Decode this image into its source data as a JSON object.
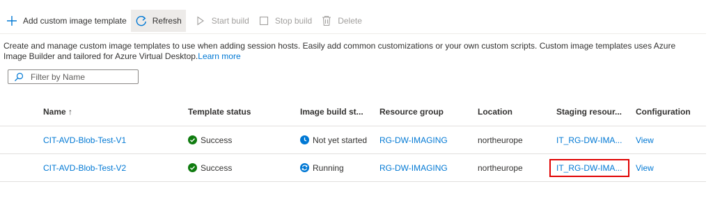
{
  "toolbar": {
    "add_label": "Add custom image template",
    "refresh_label": "Refresh",
    "start_label": "Start build",
    "stop_label": "Stop build",
    "delete_label": "Delete"
  },
  "description": {
    "text": "Create and manage custom image templates to use when adding session hosts. Easily add common customizations or your own custom scripts. Custom image templates uses Azure Image Builder and tailored for Azure Virtual Desktop.",
    "link": "Learn more"
  },
  "filter": {
    "placeholder": "Filter by Name",
    "value": ""
  },
  "table": {
    "headers": {
      "name": "Name ↑",
      "template_status": "Template status",
      "image_build_status": "Image build st...",
      "resource_group": "Resource group",
      "location": "Location",
      "staging_resource": "Staging resour...",
      "configuration": "Configuration"
    },
    "rows": [
      {
        "name": "CIT-AVD-Blob-Test-V1",
        "template_status": "Success",
        "image_build_status": "Not yet started",
        "resource_group": "RG-DW-IMAGING",
        "location": "northeurope",
        "staging_resource": "IT_RG-DW-IMA...",
        "configuration": "View"
      },
      {
        "name": "CIT-AVD-Blob-Test-V2",
        "template_status": "Success",
        "image_build_status": "Running",
        "resource_group": "RG-DW-IMAGING",
        "location": "northeurope",
        "staging_resource": "IT_RG-DW-IMA...",
        "configuration": "View"
      }
    ]
  },
  "colors": {
    "accent": "#0078d4",
    "success": "#107c10",
    "info": "#0078d4",
    "highlight": "#e00000"
  }
}
